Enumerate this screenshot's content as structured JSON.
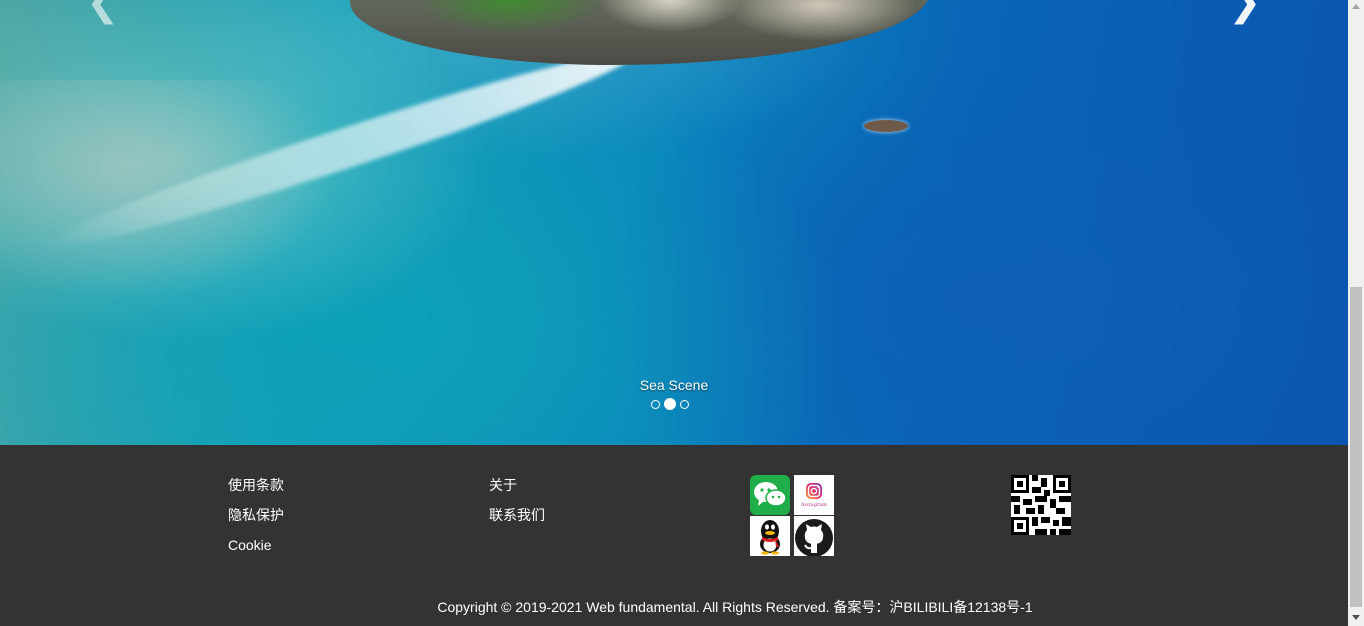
{
  "carousel": {
    "caption": "Sea Scene",
    "prev_icon": "chevron-left-icon",
    "next_icon": "chevron-right-icon",
    "prev_glyph": "❮",
    "next_glyph": "❯",
    "indicator_count": 3,
    "active_indicator": 2
  },
  "footer": {
    "links_col1": [
      "使用条款",
      "隐私保护",
      "Cookie"
    ],
    "links_col2": [
      "关于",
      "联系我们"
    ],
    "social_icons": [
      "wechat-icon",
      "instagram-icon",
      "qq-icon",
      "github-icon"
    ],
    "instagram_wordmark": "Instagram",
    "qr_icon": "qr-code-icon",
    "copyright": "Copyright © 2019-2021 Web fundamental. All Rights Reserved. 备案号：沪BILIBILI备12138号-1"
  },
  "colors": {
    "footer_bg": "#333333",
    "wechat_green": "#1fae49"
  }
}
